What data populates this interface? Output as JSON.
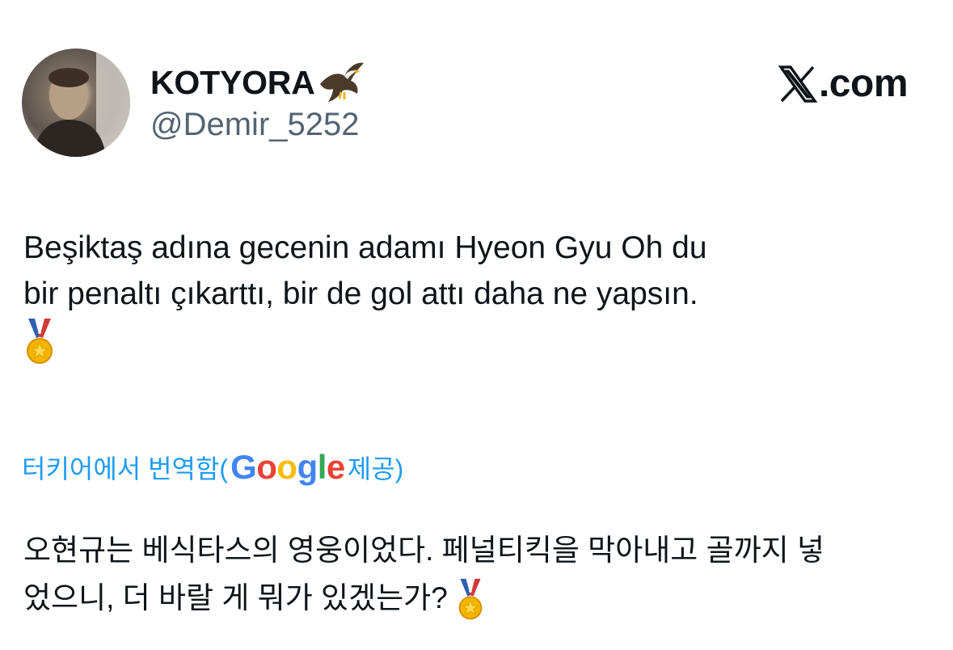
{
  "author": {
    "display_name": "KOTYORA",
    "name_emoji": "eagle-emoji",
    "handle": "@Demir_5252",
    "avatar": "user-avatar-photo"
  },
  "brand": {
    "logo_icon": "x-logo-icon",
    "text": ".com"
  },
  "tweet": {
    "line_1": "Beşiktaş adına gecenin adamı Hyeon Gyu Oh du",
    "line_2": "bir penaltı çıkarttı, bir de gol attı daha ne yapsın.",
    "emoji": "medal-emoji"
  },
  "translation": {
    "label_prefix": "터키어에서 번역함(",
    "provider": "Google",
    "label_suffix": " 제공)",
    "line_1": "오현규는 베식타스의 영웅이었다. 페널티킥을 막아내고 골까지 넣",
    "line_2": "었으니, 더 바랄 게 뭐가 있겠는가?",
    "emoji": "medal-emoji"
  },
  "colors": {
    "link_blue": "#1d9bf0",
    "handle_gray": "#536471",
    "text": "#0f1419"
  }
}
